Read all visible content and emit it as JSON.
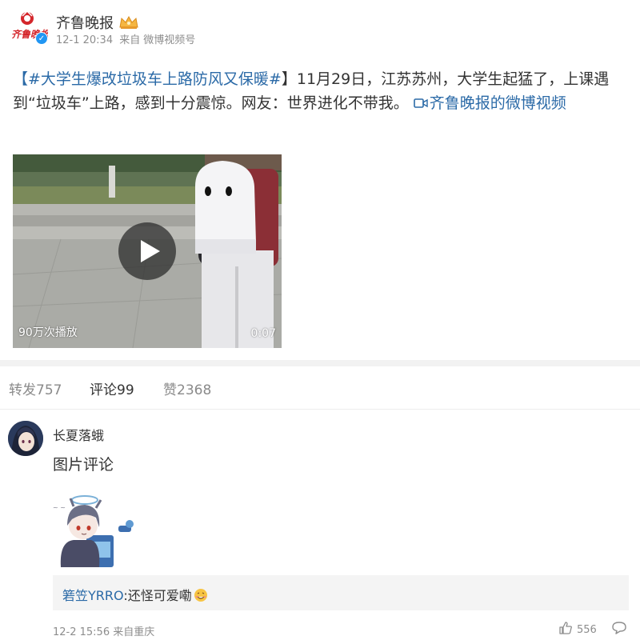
{
  "post": {
    "account_name": "齐鲁晚报",
    "logo_text": "齐鲁晚报",
    "time": "12-1 20:34",
    "source_prefix": "来自",
    "source": "微博视频号",
    "text_open_bracket": "【",
    "hashtag": "#大学生爆改垃圾车上路防风又保暖#",
    "text_body": "】11月29日，江苏苏州，大学生起猛了，上课遇到“垃圾车”上路，感到十分震惊。网友：世界进化不带我。",
    "video_link": "齐鲁晚报的微博视频"
  },
  "video": {
    "play_count": "90万次播放",
    "duration": "0:07"
  },
  "tabs": {
    "repost": "转发757",
    "comments": "评论99",
    "likes": "赞2368"
  },
  "comment": {
    "username": "长夏落蛾",
    "text": "图片评论",
    "reply_user": "箬笠YRRO",
    "reply_text": ":还怪可爱嘞",
    "time": "12-2 15:56",
    "location_prefix": "来自",
    "location": "重庆",
    "like_count": "556"
  },
  "colors": {
    "link": "#2b6aa7",
    "meta": "#8d8d8d",
    "text": "#333333",
    "logo_red": "#d4262b",
    "verified": "#2196f3"
  },
  "icons": [
    "logo-icon",
    "crown-icon",
    "verified-icon",
    "video-camera-icon",
    "play-icon",
    "emoji-icon",
    "thumbs-up-icon",
    "reply-icon"
  ]
}
